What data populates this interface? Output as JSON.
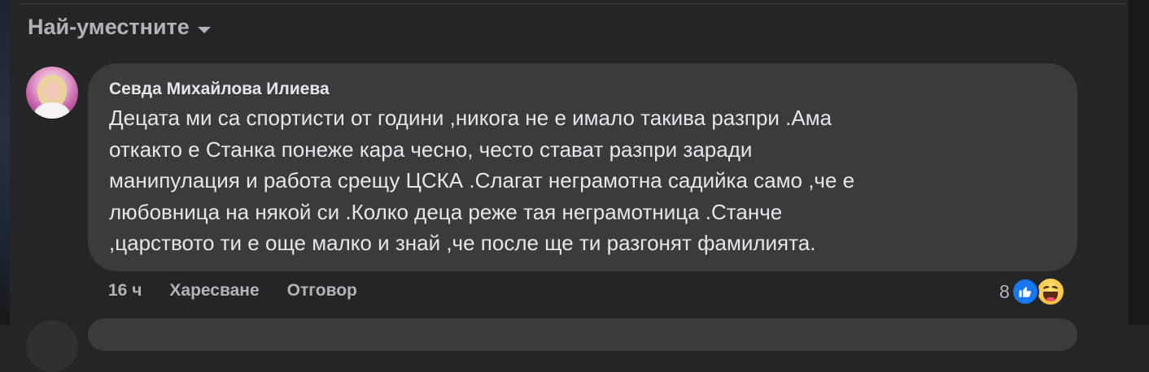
{
  "sort": {
    "label": "Най-уместните",
    "icon": "chevron-down-icon"
  },
  "comment": {
    "author": "Севда Михайлова Илиева",
    "lines": [
      "Децата ми са спортисти от години ,никога не е имало такива разпри .Ама",
      "откакто е Станка понеже кара чесно, често стават разпри заради",
      "манипулация и работа срещу ЦСКА .Слагат неграмотна садийка само ,че е",
      "любовница на някой си .Колко деца реже тая неграмотница .Станче",
      ",царството ти е още малко и знай ,че после ще ти разгонят фамилията."
    ],
    "time": "16 ч",
    "like_label": "Харесване",
    "reply_label": "Отговор",
    "reaction_count": "8",
    "reaction_icons": [
      "like-icon",
      "haha-icon"
    ],
    "colors": {
      "like": "#1877f2",
      "bubble": "#3a3b3c",
      "background": "#242526"
    }
  }
}
